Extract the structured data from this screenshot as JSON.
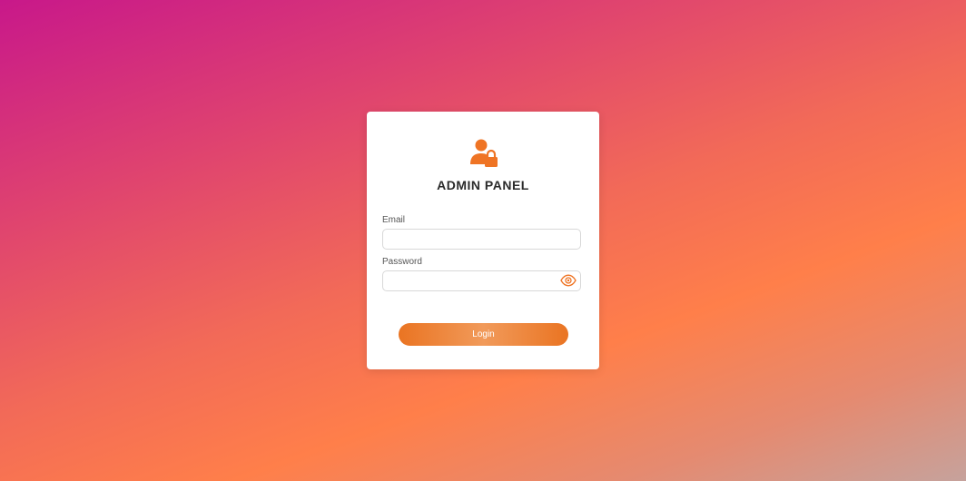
{
  "panel": {
    "title": "ADMIN PANEL",
    "logo_icon": "user-lock-icon"
  },
  "form": {
    "email_label": "Email",
    "email_value": "",
    "password_label": "Password",
    "password_value": "",
    "password_toggle_icon": "eye-icon",
    "login_label": "Login"
  },
  "colors": {
    "accent": "#ef7424",
    "button_gradient_start": "#ea7422",
    "button_gradient_mid": "#f19a5a",
    "background_top_left": "#c8188a",
    "background_center": "#ff7f4a",
    "background_bottom_right": "#c6a29c",
    "card": "#ffffff",
    "title_text": "#2b2b2b"
  }
}
